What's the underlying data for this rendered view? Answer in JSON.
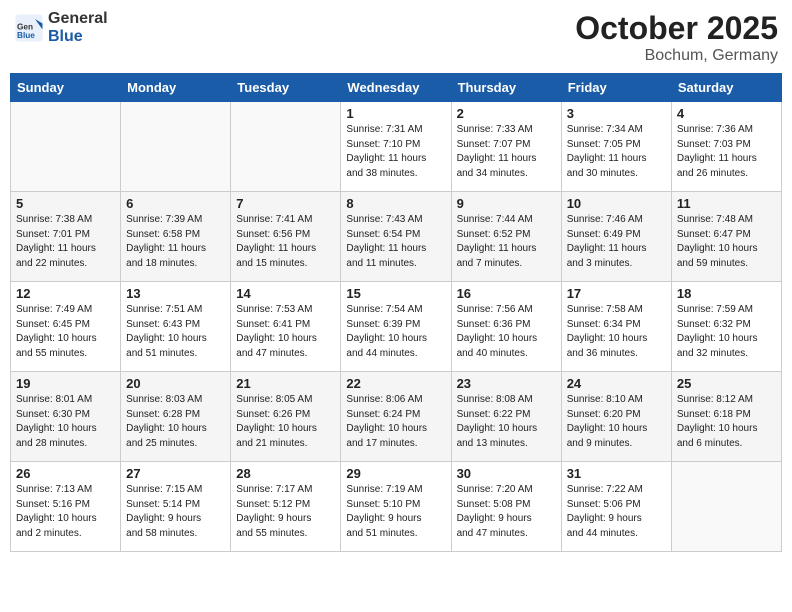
{
  "header": {
    "logo_line1": "General",
    "logo_line2": "Blue",
    "month": "October 2025",
    "location": "Bochum, Germany"
  },
  "weekdays": [
    "Sunday",
    "Monday",
    "Tuesday",
    "Wednesday",
    "Thursday",
    "Friday",
    "Saturday"
  ],
  "weeks": [
    [
      {
        "day": "",
        "info": ""
      },
      {
        "day": "",
        "info": ""
      },
      {
        "day": "",
        "info": ""
      },
      {
        "day": "1",
        "info": "Sunrise: 7:31 AM\nSunset: 7:10 PM\nDaylight: 11 hours\nand 38 minutes."
      },
      {
        "day": "2",
        "info": "Sunrise: 7:33 AM\nSunset: 7:07 PM\nDaylight: 11 hours\nand 34 minutes."
      },
      {
        "day": "3",
        "info": "Sunrise: 7:34 AM\nSunset: 7:05 PM\nDaylight: 11 hours\nand 30 minutes."
      },
      {
        "day": "4",
        "info": "Sunrise: 7:36 AM\nSunset: 7:03 PM\nDaylight: 11 hours\nand 26 minutes."
      }
    ],
    [
      {
        "day": "5",
        "info": "Sunrise: 7:38 AM\nSunset: 7:01 PM\nDaylight: 11 hours\nand 22 minutes."
      },
      {
        "day": "6",
        "info": "Sunrise: 7:39 AM\nSunset: 6:58 PM\nDaylight: 11 hours\nand 18 minutes."
      },
      {
        "day": "7",
        "info": "Sunrise: 7:41 AM\nSunset: 6:56 PM\nDaylight: 11 hours\nand 15 minutes."
      },
      {
        "day": "8",
        "info": "Sunrise: 7:43 AM\nSunset: 6:54 PM\nDaylight: 11 hours\nand 11 minutes."
      },
      {
        "day": "9",
        "info": "Sunrise: 7:44 AM\nSunset: 6:52 PM\nDaylight: 11 hours\nand 7 minutes."
      },
      {
        "day": "10",
        "info": "Sunrise: 7:46 AM\nSunset: 6:49 PM\nDaylight: 11 hours\nand 3 minutes."
      },
      {
        "day": "11",
        "info": "Sunrise: 7:48 AM\nSunset: 6:47 PM\nDaylight: 10 hours\nand 59 minutes."
      }
    ],
    [
      {
        "day": "12",
        "info": "Sunrise: 7:49 AM\nSunset: 6:45 PM\nDaylight: 10 hours\nand 55 minutes."
      },
      {
        "day": "13",
        "info": "Sunrise: 7:51 AM\nSunset: 6:43 PM\nDaylight: 10 hours\nand 51 minutes."
      },
      {
        "day": "14",
        "info": "Sunrise: 7:53 AM\nSunset: 6:41 PM\nDaylight: 10 hours\nand 47 minutes."
      },
      {
        "day": "15",
        "info": "Sunrise: 7:54 AM\nSunset: 6:39 PM\nDaylight: 10 hours\nand 44 minutes."
      },
      {
        "day": "16",
        "info": "Sunrise: 7:56 AM\nSunset: 6:36 PM\nDaylight: 10 hours\nand 40 minutes."
      },
      {
        "day": "17",
        "info": "Sunrise: 7:58 AM\nSunset: 6:34 PM\nDaylight: 10 hours\nand 36 minutes."
      },
      {
        "day": "18",
        "info": "Sunrise: 7:59 AM\nSunset: 6:32 PM\nDaylight: 10 hours\nand 32 minutes."
      }
    ],
    [
      {
        "day": "19",
        "info": "Sunrise: 8:01 AM\nSunset: 6:30 PM\nDaylight: 10 hours\nand 28 minutes."
      },
      {
        "day": "20",
        "info": "Sunrise: 8:03 AM\nSunset: 6:28 PM\nDaylight: 10 hours\nand 25 minutes."
      },
      {
        "day": "21",
        "info": "Sunrise: 8:05 AM\nSunset: 6:26 PM\nDaylight: 10 hours\nand 21 minutes."
      },
      {
        "day": "22",
        "info": "Sunrise: 8:06 AM\nSunset: 6:24 PM\nDaylight: 10 hours\nand 17 minutes."
      },
      {
        "day": "23",
        "info": "Sunrise: 8:08 AM\nSunset: 6:22 PM\nDaylight: 10 hours\nand 13 minutes."
      },
      {
        "day": "24",
        "info": "Sunrise: 8:10 AM\nSunset: 6:20 PM\nDaylight: 10 hours\nand 9 minutes."
      },
      {
        "day": "25",
        "info": "Sunrise: 8:12 AM\nSunset: 6:18 PM\nDaylight: 10 hours\nand 6 minutes."
      }
    ],
    [
      {
        "day": "26",
        "info": "Sunrise: 7:13 AM\nSunset: 5:16 PM\nDaylight: 10 hours\nand 2 minutes."
      },
      {
        "day": "27",
        "info": "Sunrise: 7:15 AM\nSunset: 5:14 PM\nDaylight: 9 hours\nand 58 minutes."
      },
      {
        "day": "28",
        "info": "Sunrise: 7:17 AM\nSunset: 5:12 PM\nDaylight: 9 hours\nand 55 minutes."
      },
      {
        "day": "29",
        "info": "Sunrise: 7:19 AM\nSunset: 5:10 PM\nDaylight: 9 hours\nand 51 minutes."
      },
      {
        "day": "30",
        "info": "Sunrise: 7:20 AM\nSunset: 5:08 PM\nDaylight: 9 hours\nand 47 minutes."
      },
      {
        "day": "31",
        "info": "Sunrise: 7:22 AM\nSunset: 5:06 PM\nDaylight: 9 hours\nand 44 minutes."
      },
      {
        "day": "",
        "info": ""
      }
    ]
  ]
}
